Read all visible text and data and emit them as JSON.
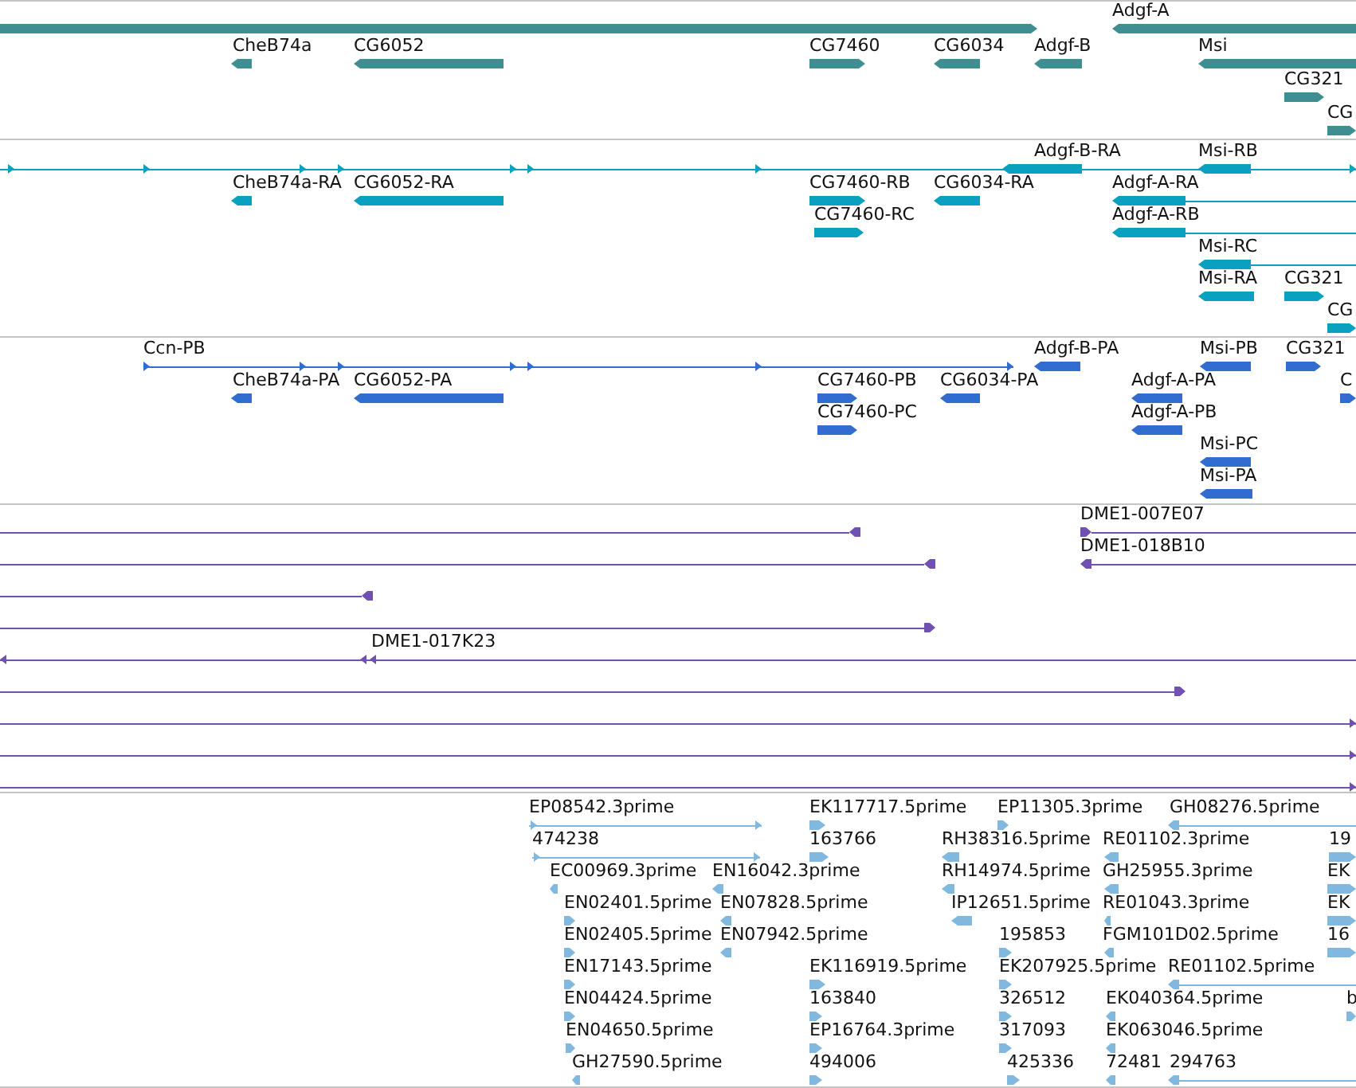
{
  "tracks": [
    {
      "color": "#3f8e92",
      "features": [
        {
          "reverse": false
        },
        {
          "label": "Adgf-A",
          "reverse": true
        },
        {
          "label": "CheB74a",
          "reverse": true
        },
        {
          "label": "CG6052",
          "reverse": true
        },
        {
          "label": "CG7460",
          "reverse": false
        },
        {
          "label": "CG6034",
          "reverse": true
        },
        {
          "label": "Adgf-B",
          "reverse": true
        },
        {
          "label": "Msi",
          "reverse": true
        },
        {
          "label": "CG321",
          "reverse": false
        },
        {
          "label": "CG",
          "reverse": false
        }
      ]
    },
    {
      "color": "#0aa0c0",
      "features": [
        {
          "reverse": false
        },
        {
          "label": "Adgf-B-RA",
          "reverse": true
        },
        {
          "label": "Msi-RB",
          "reverse": true
        },
        {
          "label": "CheB74a-RA",
          "reverse": true
        },
        {
          "label": "CG6052-RA",
          "reverse": true
        },
        {
          "label": "CG7460-RB",
          "reverse": false
        },
        {
          "label": "CG6034-RA",
          "reverse": true
        },
        {
          "label": "Adgf-A-RA",
          "reverse": true
        },
        {
          "label": "CG7460-RC",
          "reverse": false
        },
        {
          "label": "Adgf-A-RB",
          "reverse": true
        },
        {
          "label": "Msi-RC",
          "reverse": true
        },
        {
          "label": "Msi-RA",
          "reverse": true
        },
        {
          "label": "CG321",
          "reverse": false
        },
        {
          "label": "CG",
          "reverse": false
        }
      ]
    },
    {
      "color": "#316cd0",
      "features": [
        {
          "label": "Ccn-PB",
          "reverse": false
        },
        {
          "label": "Adgf-B-PA",
          "reverse": true
        },
        {
          "label": "Msi-PB",
          "reverse": true
        },
        {
          "label": "CG321",
          "reverse": false
        },
        {
          "label": "CheB74a-PA",
          "reverse": true
        },
        {
          "label": "CG6052-PA",
          "reverse": true
        },
        {
          "label": "CG7460-PB",
          "reverse": false
        },
        {
          "label": "CG6034-PA",
          "reverse": true
        },
        {
          "label": "Adgf-A-PA",
          "reverse": true
        },
        {
          "label": "C",
          "reverse": false
        },
        {
          "label": "CG7460-PC",
          "reverse": false
        },
        {
          "label": "Adgf-A-PB",
          "reverse": true
        },
        {
          "label": "Msi-PC",
          "reverse": true
        },
        {
          "label": "Msi-PA",
          "reverse": true
        }
      ]
    },
    {
      "color": "#7050b0",
      "features": [
        {
          "reverse": true
        },
        {
          "label": "DME1-007E07",
          "reverse": false
        },
        {
          "reverse": true
        },
        {
          "label": "DME1-018B10",
          "reverse": true
        },
        {
          "reverse": true
        },
        {
          "reverse": false
        },
        {
          "label": "DME1-017K23",
          "reverse": true
        },
        {
          "reverse": false
        },
        {
          "reverse": false
        },
        {
          "reverse": false
        },
        {
          "reverse": false
        }
      ]
    },
    {
      "color": "#80b8e0",
      "features": [
        {
          "label": "EP08542.3prime",
          "reverse": false
        },
        {
          "label": "EK117717.5prime",
          "reverse": false
        },
        {
          "label": "EP11305.3prime",
          "reverse": false
        },
        {
          "label": "GH08276.5prime",
          "reverse": true
        },
        {
          "label": "474238",
          "reverse": false
        },
        {
          "label": "163766",
          "reverse": false
        },
        {
          "label": "RH38316.5prime",
          "reverse": true
        },
        {
          "label": "RE01102.3prime",
          "reverse": true
        },
        {
          "label": "19",
          "reverse": false
        },
        {
          "label": "EC00969.3prime",
          "reverse": true
        },
        {
          "label": "EN16042.3prime",
          "reverse": true
        },
        {
          "label": "RH14974.5prime",
          "reverse": true
        },
        {
          "label": "GH25955.3prime",
          "reverse": true
        },
        {
          "label": "EK",
          "reverse": false
        },
        {
          "label": "EN02401.5prime",
          "reverse": false
        },
        {
          "label": "EN07828.5prime",
          "reverse": true
        },
        {
          "label": "IP12651.5prime",
          "reverse": true
        },
        {
          "label": "RE01043.3prime",
          "reverse": true
        },
        {
          "label": "EK",
          "reverse": false
        },
        {
          "label": "EN02405.5prime",
          "reverse": false
        },
        {
          "label": "EN07942.5prime",
          "reverse": true
        },
        {
          "label": "195853",
          "reverse": false
        },
        {
          "label": "FGM101D02.5prime",
          "reverse": true
        },
        {
          "label": "16",
          "reverse": false
        },
        {
          "label": "EN17143.5prime",
          "reverse": false
        },
        {
          "label": "EK116919.5prime",
          "reverse": false
        },
        {
          "label": "EK207925.5prime",
          "reverse": false
        },
        {
          "label": "RE01102.5prime",
          "reverse": true
        },
        {
          "label": "EN04424.5prime",
          "reverse": false
        },
        {
          "label": "163840",
          "reverse": false
        },
        {
          "label": "326512",
          "reverse": false
        },
        {
          "label": "EK040364.5prime",
          "reverse": true
        },
        {
          "label": "b",
          "reverse": false
        },
        {
          "label": "EN04650.5prime",
          "reverse": false
        },
        {
          "label": "EP16764.3prime",
          "reverse": false
        },
        {
          "label": "317093",
          "reverse": false
        },
        {
          "label": "EK063046.5prime",
          "reverse": true
        },
        {
          "label": "GH27590.5prime",
          "reverse": true
        },
        {
          "label": "494006",
          "reverse": false
        },
        {
          "label": "425336",
          "reverse": false
        },
        {
          "label": "72481",
          "reverse": true
        },
        {
          "label": "294763",
          "reverse": true
        }
      ]
    }
  ]
}
